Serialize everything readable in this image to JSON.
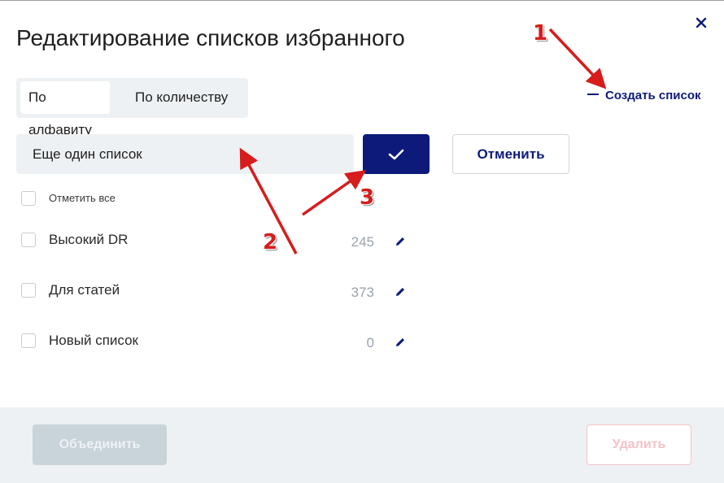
{
  "dialog": {
    "title": "Редактирование списков избранного",
    "close_icon": "close-icon"
  },
  "sort": {
    "options": [
      "По алфавиту",
      "По количеству"
    ],
    "active": "По алфавиту"
  },
  "create_list": {
    "label": "Создать список"
  },
  "new_list": {
    "value": "Еще один список",
    "confirm_icon": "check-icon",
    "cancel_label": "Отменить"
  },
  "select_all": {
    "label": "Отметить все",
    "checked": false
  },
  "lists": [
    {
      "name": "Высокий DR",
      "count": "245",
      "checked": false
    },
    {
      "name": "Для статей",
      "count": "373",
      "checked": false
    },
    {
      "name": "Новый список",
      "count": "0",
      "checked": false
    }
  ],
  "footer": {
    "merge_label": "Объединить",
    "delete_label": "Удалить"
  },
  "annotations": {
    "markers": [
      "1",
      "2",
      "3"
    ],
    "color": "#d61c1c"
  },
  "colors": {
    "accent": "#0d1a7a",
    "field_bg": "#eef1f3",
    "count_text": "#9aa2ad"
  }
}
